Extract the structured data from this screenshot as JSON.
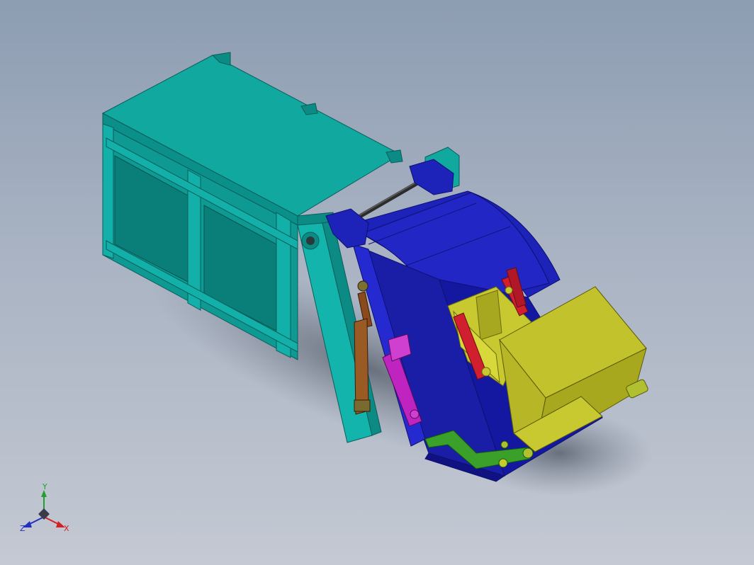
{
  "viewport": {
    "background": [
      "#8d9db2",
      "#c4c9d3"
    ]
  },
  "model": {
    "parts": [
      {
        "name": "container-body",
        "color": "#0f9e97"
      },
      {
        "name": "compactor-housing",
        "color": "#1a1fa8"
      },
      {
        "name": "hopper",
        "color": "#b8b82a"
      },
      {
        "name": "lift-cylinder",
        "color": "#8a4a1c"
      },
      {
        "name": "tilt-cylinder",
        "color": "#c024c0"
      },
      {
        "name": "packer-cylinder",
        "color": "#d02030"
      },
      {
        "name": "lift-arm",
        "color": "#3aa02a"
      },
      {
        "name": "pivot-rod",
        "color": "#3a3a3a"
      }
    ]
  },
  "triad": {
    "x_label": "X",
    "y_label": "Y",
    "z_label": "Z",
    "x_color": "#d42020",
    "y_color": "#20a030",
    "z_color": "#2030c0"
  }
}
